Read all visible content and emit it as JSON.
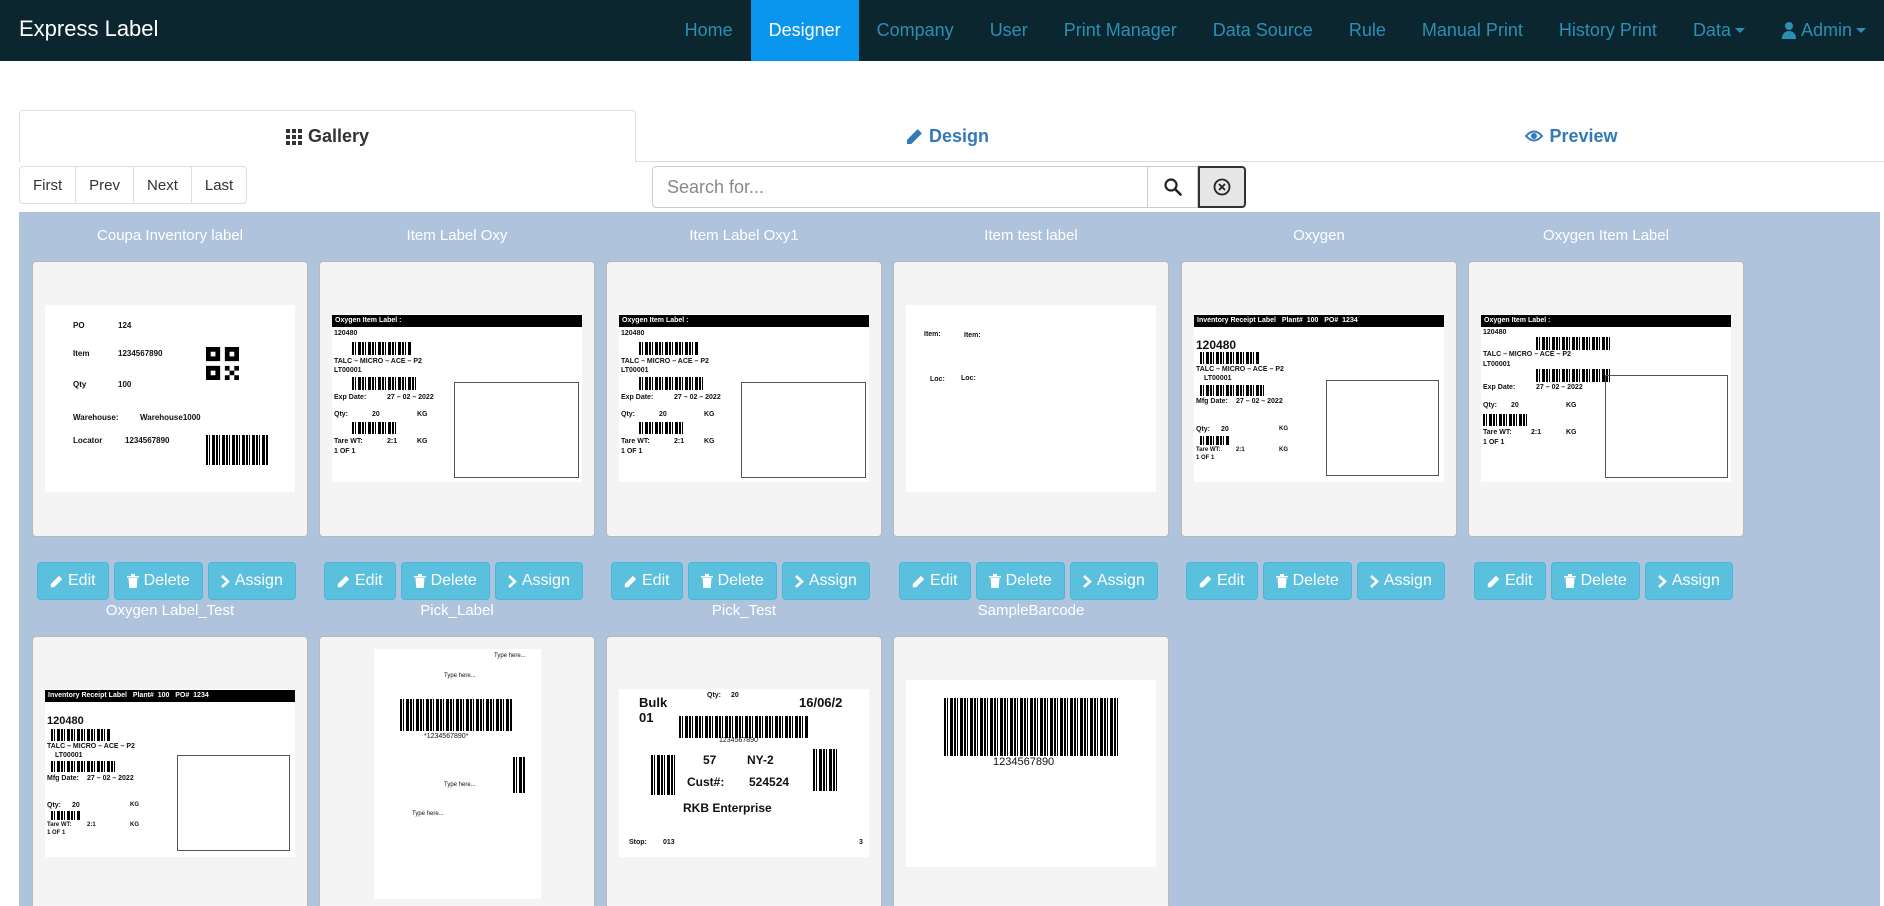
{
  "app": {
    "title": "Express Label"
  },
  "nav": {
    "items": [
      {
        "label": "Home"
      },
      {
        "label": "Designer"
      },
      {
        "label": "Company"
      },
      {
        "label": "User"
      },
      {
        "label": "Print Manager"
      },
      {
        "label": "Data Source"
      },
      {
        "label": "Rule"
      },
      {
        "label": "Manual Print"
      },
      {
        "label": "History Print"
      },
      {
        "label": "Data"
      },
      {
        "label": "Admin"
      }
    ],
    "active": "Designer"
  },
  "tabs": [
    {
      "label": "Gallery",
      "icon": "grid-icon"
    },
    {
      "label": "Design",
      "icon": "pencil-icon"
    },
    {
      "label": "Preview",
      "icon": "eye-icon"
    }
  ],
  "pager": [
    "First",
    "Prev",
    "Next",
    "Last"
  ],
  "search": {
    "placeholder": "Search for..."
  },
  "buttons": {
    "edit": "Edit",
    "delete": "Delete",
    "assign": "Assign"
  },
  "labels": [
    {
      "name": "Coupa Inventory label"
    },
    {
      "name": "Item Label Oxy"
    },
    {
      "name": "Item Label Oxy1"
    },
    {
      "name": "Item test label"
    },
    {
      "name": "Oxygen"
    },
    {
      "name": "Oxygen Item Label"
    },
    {
      "name": "Oxygen Label_Test"
    },
    {
      "name": "Pick_Label"
    },
    {
      "name": "Pick_Test"
    },
    {
      "name": "SampleBarcode"
    }
  ],
  "preview_text": {
    "coupa": {
      "po": "PO",
      "po_val": "124",
      "item": "Item",
      "item_val": "1234567890",
      "qty": "Qty",
      "qty_val": "100",
      "warehouse": "Warehouse:",
      "warehouse_val": "Warehouse1000",
      "locator": "Locator",
      "locator_val": "1234567890"
    },
    "oxy": {
      "head": "Oxygen Item Label :",
      "num": "120480",
      "desc": "TALC – MICRO – ACE – P2",
      "lot": "LT00001",
      "exp": "Exp Date:",
      "exp_val": "27 – 02 – 2022",
      "qty": "Qty:",
      "qty_val": "20",
      "kg": "KG",
      "tare": "Tare WT:",
      "tare_val": "2:1",
      "page": "1 OF 1"
    },
    "test": {
      "item": "Item:",
      "item2": "Item:",
      "loc": "Loc:",
      "loc2": "Loc:"
    },
    "inv": {
      "head": "Inventory Receipt Label",
      "plant": "Plant#",
      "plant_val": "100",
      "po": "PO#",
      "po_val": "1234",
      "num": "120480",
      "desc": "TALC – MICRO – ACE – P2",
      "lot": "LT00001",
      "mfg": "Mfg Date:",
      "mfg_val": "27 – 02 – 2022",
      "qty": "Qty:",
      "qty_val": "20",
      "kg": "KG",
      "tare": "Tare WT:",
      "tare_val": "2:1",
      "page": "1 OF 1"
    },
    "pick": {
      "type": "Type here...",
      "barcode": "*1234567890*"
    },
    "picktest": {
      "bulk": "Bulk",
      "bulk2": "01",
      "qty": "Qty:",
      "qty_val": "20",
      "date": "16/06/2",
      "num": "1234567890",
      "n57": "57",
      "ny": "NY-2",
      "cust": "Cust#:",
      "cust_val": "524524",
      "ent": "RKB Enterprise",
      "stop": "Stop:",
      "stop_val": "013",
      "three": "3"
    },
    "sample": {
      "barcode": "1234567890"
    }
  }
}
